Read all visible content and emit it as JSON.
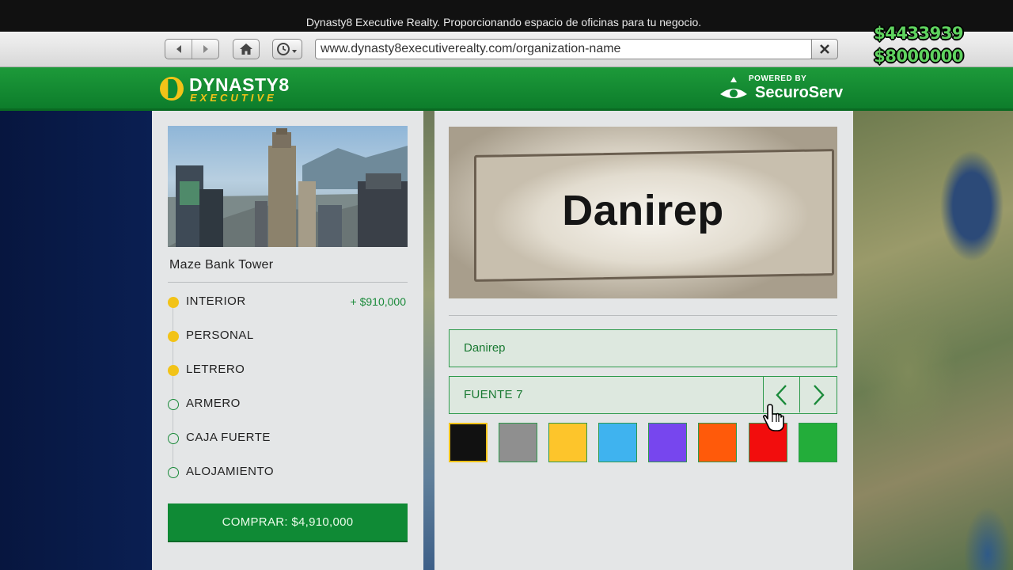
{
  "window": {
    "title": "Dynasty8 Executive Realty. Proporcionando espacio de oficinas para tu negocio."
  },
  "toolbar": {
    "back_icon": "back-arrow-icon",
    "forward_icon": "forward-arrow-icon",
    "home_icon": "home-icon",
    "history_icon": "history-clock-icon",
    "url": "www.dynasty8executiverealty.com/organization-name",
    "close_icon": "close-icon"
  },
  "hud": {
    "cash": "$4433939",
    "bank": "$8000000",
    "cash_color": "#5fd35f"
  },
  "header": {
    "brand_name": "DYNASTY8",
    "brand_sub": "EXECUTIVE",
    "powered_by": "POWERED BY",
    "partner": "SecuroServ"
  },
  "property": {
    "name": "Maze Bank Tower",
    "options": [
      {
        "label": "INTERIOR",
        "price": "+ $910,000",
        "selected": true
      },
      {
        "label": "PERSONAL",
        "price": "",
        "selected": true
      },
      {
        "label": "LETRERO",
        "price": "",
        "selected": true
      },
      {
        "label": "ARMERO",
        "price": "",
        "selected": false
      },
      {
        "label": "CAJA FUERTE",
        "price": "",
        "selected": false
      },
      {
        "label": "ALOJAMIENTO",
        "price": "",
        "selected": false
      }
    ],
    "buy_label": "COMPRAR: $4,910,000"
  },
  "signage": {
    "preview_text": "Danirep",
    "name_value": "Danirep",
    "font_label": "FUENTE 7",
    "prev_icon": "chevron-left-icon",
    "next_icon": "chevron-right-icon",
    "colors": [
      "#111111",
      "#8f8f8f",
      "#fdc52b",
      "#3fb3ef",
      "#7746ee",
      "#ff5a0a",
      "#f20d0d",
      "#23ad3a"
    ],
    "selected_color_index": 0
  },
  "colors": {
    "accent_green": "#0f8a35",
    "highlight_yellow": "#f2c318"
  }
}
